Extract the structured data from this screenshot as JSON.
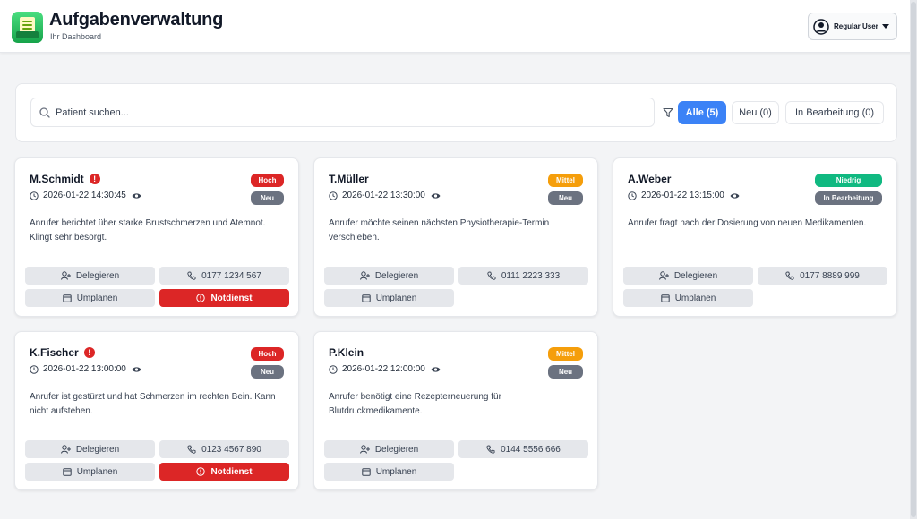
{
  "header": {
    "title": "Aufgabenverwaltung",
    "subtitle": "Ihr Dashboard",
    "user": "Regular User"
  },
  "filters": {
    "search_placeholder": "Patient suchen...",
    "chips": [
      "Alle (5)",
      "Neu (0)",
      "In Bearbeitung (0)"
    ],
    "active_chip": "Alle (5)"
  },
  "colors": {
    "accent": "#3b82f6",
    "hoch": "#dc2626",
    "mittel": "#f59e0b",
    "niedrig": "#10b981",
    "status": "#6b7280"
  },
  "cards": [
    {
      "name": "M.Schmidt",
      "urgent": true,
      "time": "2026-01-22 14:30:45",
      "priority": "Hoch",
      "status": "Neu",
      "description": "Anrufer berichtet über starke Brustschmerzen und Atemnot. Klingt sehr besorgt.",
      "delegate": "Delegieren",
      "phone": "0177 1234 567",
      "reschedule": "Umplanen",
      "emergency": "Notdienst"
    },
    {
      "name": "T.Müller",
      "urgent": false,
      "time": "2026-01-22 13:30:00",
      "priority": "Mittel",
      "status": "Neu",
      "description": "Anrufer möchte seinen nächsten Physiotherapie-Termin verschieben.",
      "delegate": "Delegieren",
      "phone": "0111 2223 333",
      "reschedule": "Umplanen"
    },
    {
      "name": "A.Weber",
      "urgent": false,
      "time": "2026-01-22 13:15:00",
      "priority": "Niedrig",
      "status": "In Bearbeitung",
      "description": "Anrufer fragt nach der Dosierung von neuen Medikamenten.",
      "delegate": "Delegieren",
      "phone": "0177 8889 999",
      "reschedule": "Umplanen"
    },
    {
      "name": "K.Fischer",
      "urgent": true,
      "time": "2026-01-22 13:00:00",
      "priority": "Hoch",
      "status": "Neu",
      "description": "Anrufer ist gestürzt und hat Schmerzen im rechten Bein. Kann nicht aufstehen.",
      "delegate": "Delegieren",
      "phone": "0123 4567 890",
      "reschedule": "Umplanen",
      "emergency": "Notdienst"
    },
    {
      "name": "P.Klein",
      "urgent": false,
      "time": "2026-01-22 12:00:00",
      "priority": "Mittel",
      "status": "Neu",
      "description": "Anrufer benötigt eine Rezepterneuerung für Blutdruckmedikamente.",
      "delegate": "Delegieren",
      "phone": "0144 5556 666",
      "reschedule": "Umplanen"
    }
  ]
}
